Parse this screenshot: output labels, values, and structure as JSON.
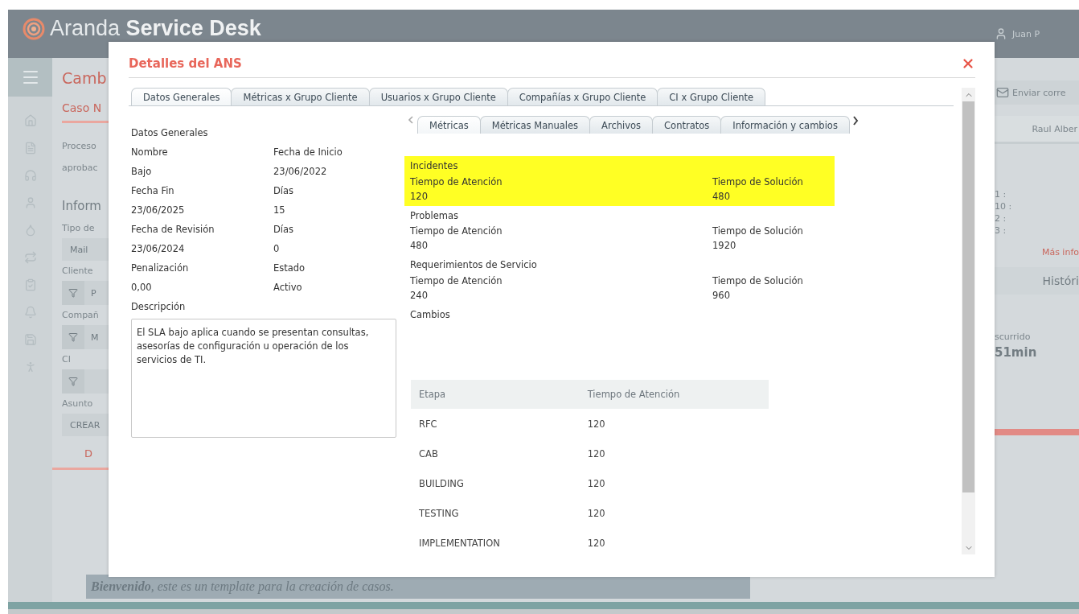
{
  "app": {
    "logo_light": "Aranda",
    "logo_bold": "Service Desk",
    "user": "Juan P"
  },
  "background_left": [
    {
      "kind": "title",
      "text": "Camb"
    },
    {
      "kind": "subtitle",
      "text": "Caso N"
    },
    {
      "kind": "text",
      "text": "Proceso"
    },
    {
      "kind": "text",
      "text": "aprobac"
    },
    {
      "kind": "heading",
      "text": "Inform"
    },
    {
      "kind": "label",
      "text": "Tipo de"
    },
    {
      "kind": "field",
      "text": "Mail"
    },
    {
      "kind": "label",
      "text": "Cliente"
    },
    {
      "kind": "filter",
      "text": "P"
    },
    {
      "kind": "label",
      "text": "Compañ"
    },
    {
      "kind": "filter",
      "text": "M"
    },
    {
      "kind": "label",
      "text": "CI"
    },
    {
      "kind": "filter"
    },
    {
      "kind": "label",
      "text": "Asunto"
    },
    {
      "kind": "field",
      "text": "CREAR"
    },
    {
      "kind": "tab",
      "text": "D"
    }
  ],
  "background_right": [
    {
      "kind": "action",
      "text": "Enviar corre"
    },
    {
      "kind": "cell",
      "text": "Raul Alber"
    },
    {
      "kind": "list",
      "items": [
        "1 :",
        "10 :",
        "2 :",
        "3 :"
      ]
    },
    {
      "kind": "link",
      "text": "Más info"
    },
    {
      "kind": "header",
      "text": "Históri"
    },
    {
      "kind": "label",
      "text": "scurrido"
    },
    {
      "kind": "value",
      "text": "51min"
    },
    {
      "kind": "bar",
      "level": 1
    }
  ],
  "welcome": "**Bienvenido**, este es un template para la creación de casos.",
  "modal": {
    "title": "Detalles del ANS",
    "tabs": [
      {
        "label": "Datos Generales",
        "selected": true
      },
      {
        "label": "Métricas x Grupo Cliente",
        "selected": false
      },
      {
        "label": "Usuarios x Grupo Cliente",
        "selected": false
      },
      {
        "label": "Compañías x Grupo Cliente",
        "selected": false
      },
      {
        "label": "CI x Grupo Cliente",
        "selected": false
      }
    ],
    "general": {
      "heading": "Datos Generales",
      "fields": [
        {
          "label": "Nombre",
          "value": "Bajo"
        },
        {
          "label": "Fecha de Inicio",
          "value": "23/06/2022"
        },
        {
          "label": "Fecha Fin",
          "value": "23/06/2025"
        },
        {
          "label": "Días",
          "value": "15"
        },
        {
          "label": "Fecha de Revisión",
          "value": "23/06/2024"
        },
        {
          "label": "Días",
          "value": "0"
        },
        {
          "label": "Penalización",
          "value": "0,00"
        },
        {
          "label": "Estado",
          "value": "Activo"
        }
      ],
      "description_label": "Descripción",
      "description": "El SLA bajo aplica cuando se presentan consultas, asesorías de configuración u operación de los servicios de TI."
    },
    "subtabs": [
      {
        "label": "Métricas",
        "selected": true
      },
      {
        "label": "Métricas Manuales",
        "selected": false
      },
      {
        "label": "Archivos",
        "selected": false
      },
      {
        "label": "Contratos",
        "selected": false
      },
      {
        "label": "Información y cambios",
        "selected": false
      }
    ],
    "metric_groups": [
      {
        "name": "Incidentes",
        "highlighted": true,
        "attention_label": "Tiempo de Atención",
        "attention": "120",
        "solution_label": "Tiempo de Solución",
        "solution": "480"
      },
      {
        "name": "Problemas",
        "highlighted": false,
        "attention_label": "Tiempo de Atención",
        "attention": "480",
        "solution_label": "Tiempo de Solución",
        "solution": "1920"
      },
      {
        "name": "Requerimientos de Servicio",
        "highlighted": false,
        "attention_label": "Tiempo de Atención",
        "attention": "240",
        "solution_label": "Tiempo de Solución",
        "solution": "960"
      },
      {
        "name": "Cambios",
        "highlighted": false
      }
    ],
    "table": {
      "columns": [
        "Etapa",
        "Tiempo de Atención"
      ],
      "rows": [
        [
          "RFC",
          "120"
        ],
        [
          "CAB",
          "120"
        ],
        [
          "BUILDING",
          "120"
        ],
        [
          "TESTING",
          "120"
        ],
        [
          "IMPLEMENTATION",
          "120"
        ]
      ]
    }
  }
}
